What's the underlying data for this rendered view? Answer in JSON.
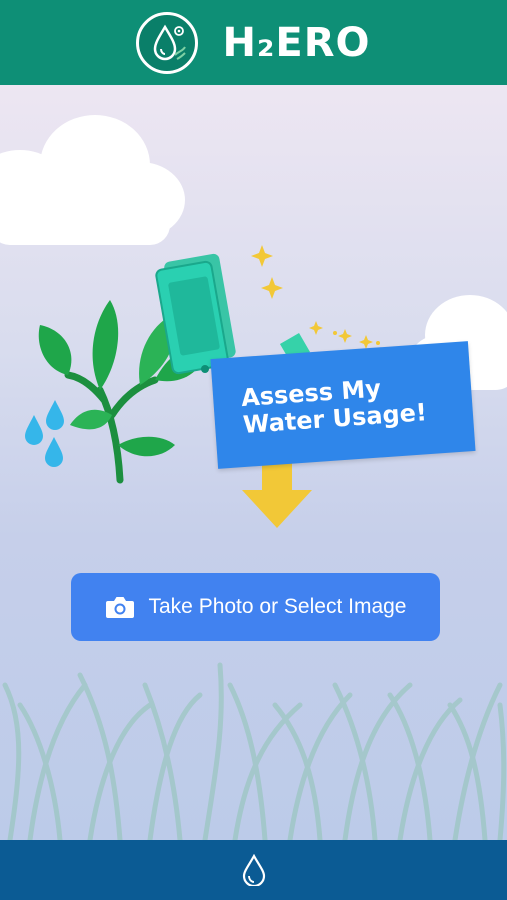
{
  "header": {
    "brand_name": "H₂ERO",
    "logo_icon": "water-drop-leaf-gear-icon",
    "background_color": "#0e8f76"
  },
  "illustration": {
    "sign_line1": "Assess My",
    "sign_line2": "Water Usage!",
    "sign_color": "#2f86ea",
    "arrow_color": "#f2c837",
    "plant_color": "#1fa64a",
    "drops_color": "#35b6ea"
  },
  "action": {
    "button_label": "Take Photo or Select Image",
    "button_icon": "camera-icon",
    "button_color": "#4182f0"
  },
  "footer": {
    "icon": "water-drop-icon",
    "background_color": "#0b5b94"
  }
}
